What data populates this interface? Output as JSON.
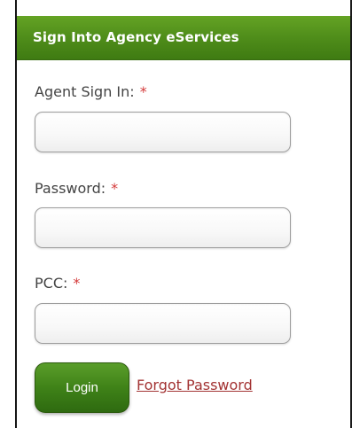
{
  "header": {
    "title": "Sign Into Agency eServices"
  },
  "form": {
    "agent_sign_in": {
      "label": "Agent Sign In:",
      "required_mark": "*",
      "value": ""
    },
    "password": {
      "label": "Password:",
      "required_mark": "*",
      "value": ""
    },
    "pcc": {
      "label": "PCC:",
      "required_mark": "*",
      "value": ""
    }
  },
  "actions": {
    "login_label": "Login",
    "forgot_password_label": "Forgot Password"
  },
  "colors": {
    "header_green": "#4f8d1a",
    "button_green": "#3f8218",
    "required_red": "#d43a3a",
    "link_red": "#a33333"
  }
}
